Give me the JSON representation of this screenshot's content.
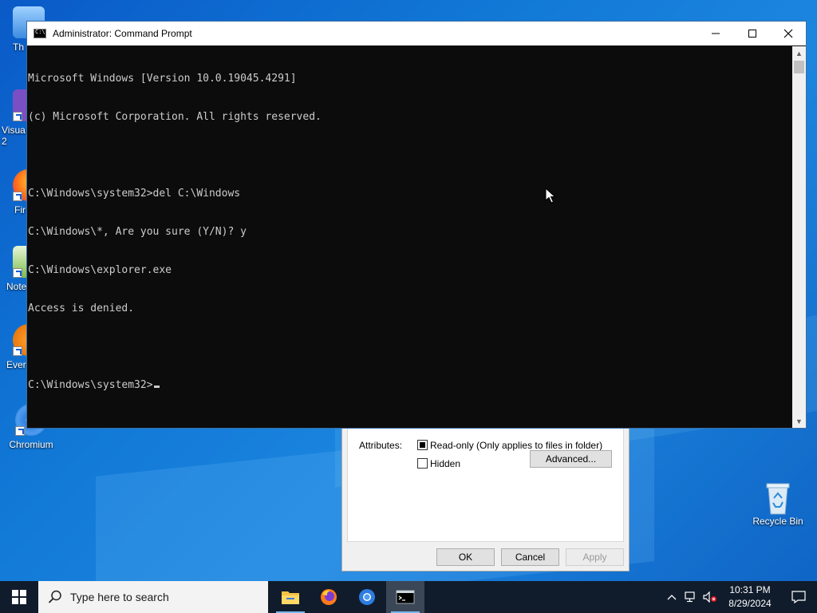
{
  "desktop_icons": [
    {
      "name": "this-pc-icon",
      "label": "Th"
    },
    {
      "name": "visual-studio-icon",
      "label": "Visua\n2"
    },
    {
      "name": "firefox-desktop-icon",
      "label": "Fir"
    },
    {
      "name": "notepad-icon",
      "label": "Note"
    },
    {
      "name": "everything-icon",
      "label": "Ever"
    },
    {
      "name": "chromium-desktop-icon",
      "label": "Chromium"
    },
    {
      "name": "recycle-bin-icon",
      "label": "Recycle Bin"
    }
  ],
  "properties_dialog": {
    "attributes_label": "Attributes:",
    "readonly_label": "Read-only (Only applies to files in folder)",
    "hidden_label": "Hidden",
    "advanced_label": "Advanced...",
    "ok_label": "OK",
    "cancel_label": "Cancel",
    "apply_label": "Apply"
  },
  "cmd_window": {
    "title": "Administrator: Command Prompt",
    "lines": [
      "Microsoft Windows [Version 10.0.19045.4291]",
      "(c) Microsoft Corporation. All rights reserved.",
      "",
      "C:\\Windows\\system32>del C:\\Windows",
      "C:\\Windows\\*, Are you sure (Y/N)? y",
      "C:\\Windows\\explorer.exe",
      "Access is denied.",
      "",
      "C:\\Windows\\system32>"
    ]
  },
  "taskbar": {
    "search_placeholder": "Type here to search",
    "apps": [
      "file-explorer",
      "firefox",
      "chromium",
      "command-prompt"
    ],
    "time": "10:31 PM",
    "date": "8/29/2024"
  }
}
